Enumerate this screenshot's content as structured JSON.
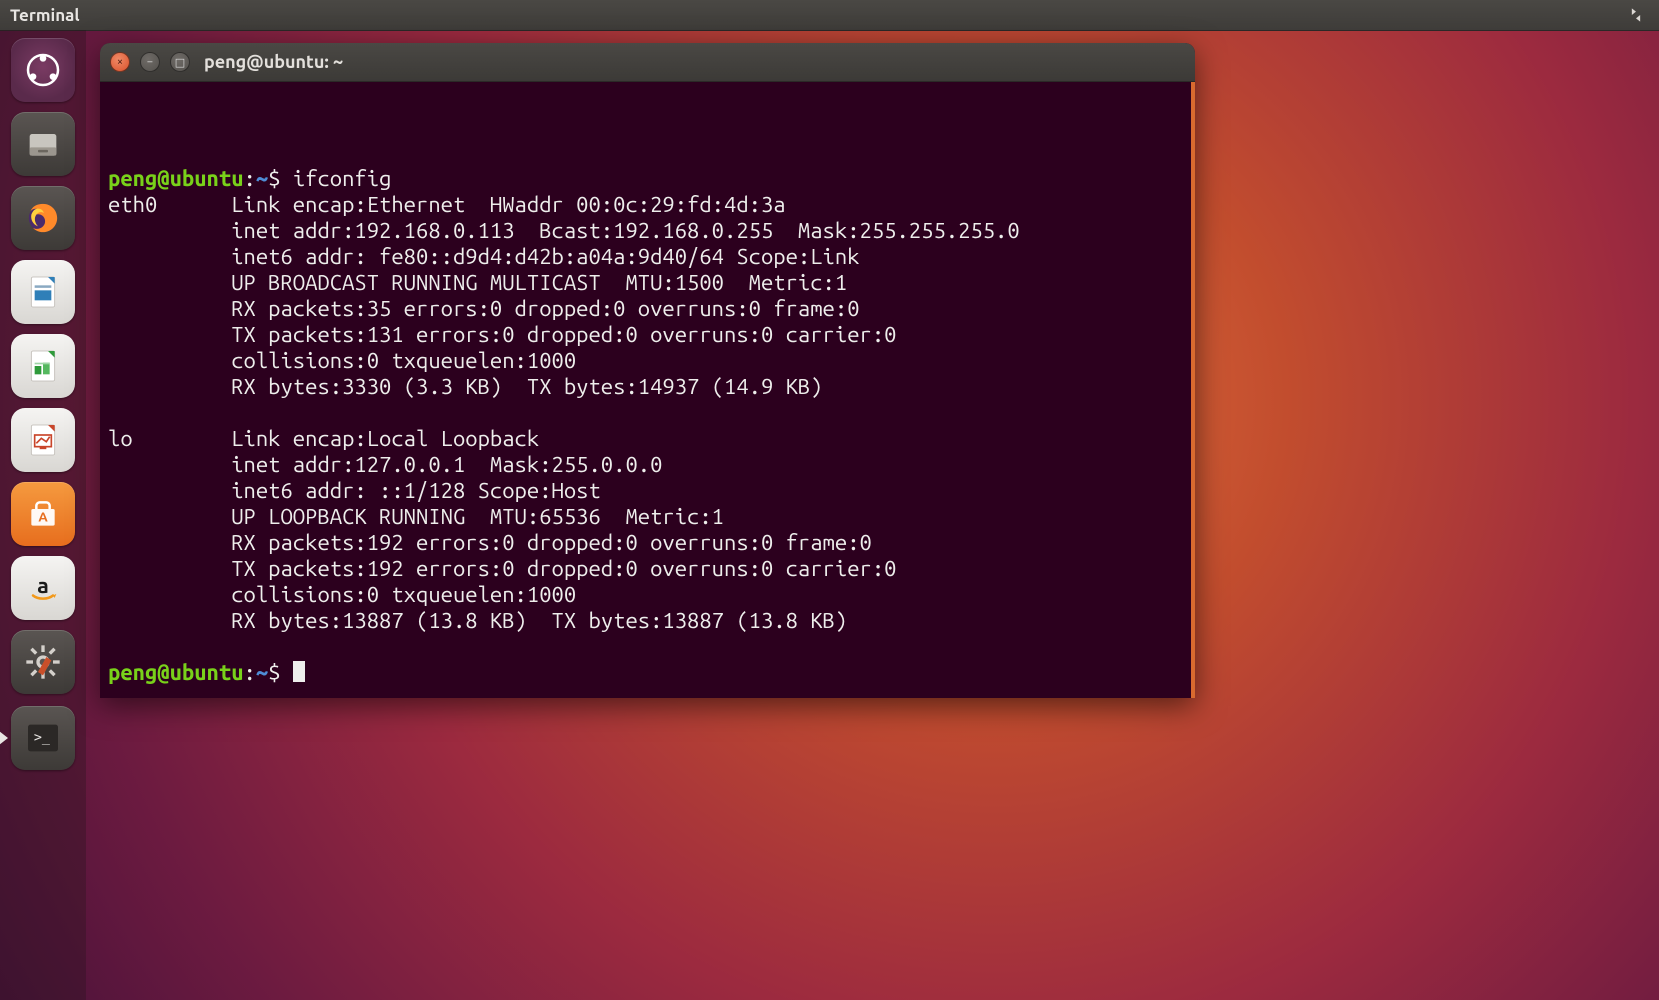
{
  "menubar": {
    "title": "Terminal"
  },
  "launcher": {
    "items": [
      {
        "name": "dash-icon",
        "label": "Dash"
      },
      {
        "name": "files-icon",
        "label": "Files"
      },
      {
        "name": "firefox-icon",
        "label": "Firefox"
      },
      {
        "name": "writer-icon",
        "label": "LibreOffice Writer"
      },
      {
        "name": "calc-icon",
        "label": "LibreOffice Calc"
      },
      {
        "name": "impress-icon",
        "label": "LibreOffice Impress"
      },
      {
        "name": "software-icon",
        "label": "Ubuntu Software"
      },
      {
        "name": "amazon-icon",
        "label": "Amazon"
      },
      {
        "name": "settings-icon",
        "label": "System Settings"
      },
      {
        "name": "terminal-icon",
        "label": "Terminal"
      }
    ]
  },
  "window": {
    "title": "peng@ubuntu: ~",
    "controls": {
      "close": "×",
      "minimize": "−",
      "maximize": "□"
    }
  },
  "terminal": {
    "prompt_user": "peng@ubuntu",
    "prompt_sep": ":",
    "prompt_path": "~",
    "prompt_dollar": "$",
    "command": "ifconfig",
    "output_lines": [
      "eth0      Link encap:Ethernet  HWaddr 00:0c:29:fd:4d:3a  ",
      "          inet addr:192.168.0.113  Bcast:192.168.0.255  Mask:255.255.255.0",
      "          inet6 addr: fe80::d9d4:d42b:a04a:9d40/64 Scope:Link",
      "          UP BROADCAST RUNNING MULTICAST  MTU:1500  Metric:1",
      "          RX packets:35 errors:0 dropped:0 overruns:0 frame:0",
      "          TX packets:131 errors:0 dropped:0 overruns:0 carrier:0",
      "          collisions:0 txqueuelen:1000 ",
      "          RX bytes:3330 (3.3 KB)  TX bytes:14937 (14.9 KB)",
      "",
      "lo        Link encap:Local Loopback  ",
      "          inet addr:127.0.0.1  Mask:255.0.0.0",
      "          inet6 addr: ::1/128 Scope:Host",
      "          UP LOOPBACK RUNNING  MTU:65536  Metric:1",
      "          RX packets:192 errors:0 dropped:0 overruns:0 frame:0",
      "          TX packets:192 errors:0 dropped:0 overruns:0 carrier:0",
      "          collisions:0 txqueuelen:1000 ",
      "          RX bytes:13887 (13.8 KB)  TX bytes:13887 (13.8 KB)",
      ""
    ]
  }
}
